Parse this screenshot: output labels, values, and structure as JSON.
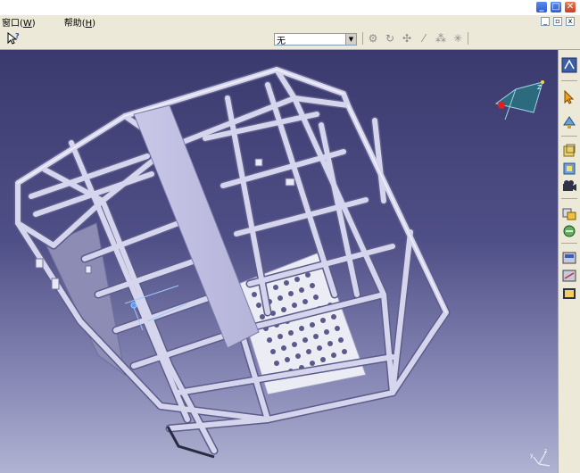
{
  "menubar": {
    "items": [
      {
        "label": "窗口",
        "key": "W"
      },
      {
        "label": "帮助",
        "key": "H"
      }
    ]
  },
  "toolbar": {
    "layer_value": "无",
    "icons": [
      "help-pointer-icon",
      "layer-filter-icon",
      "curve-icon",
      "point-icon",
      "line-icon",
      "scatter-icon",
      "grid-icon"
    ]
  },
  "right_toolbar": {
    "icons": [
      "catia-logo-icon",
      "select-arrow-icon",
      "fly-mode-icon",
      "front-view-icon",
      "render-style-icon",
      "camera-icon",
      "hide-show-icon",
      "swap-space-icon",
      "analysis-icon",
      "measure-icon",
      "scene-icon"
    ]
  },
  "viewport": {
    "background_top": "#3b3a6e",
    "background_bottom": "#b0b3d2",
    "model_color": "#d6d5ee",
    "compass": "compass-icon",
    "axis": "axis-system-icon"
  }
}
